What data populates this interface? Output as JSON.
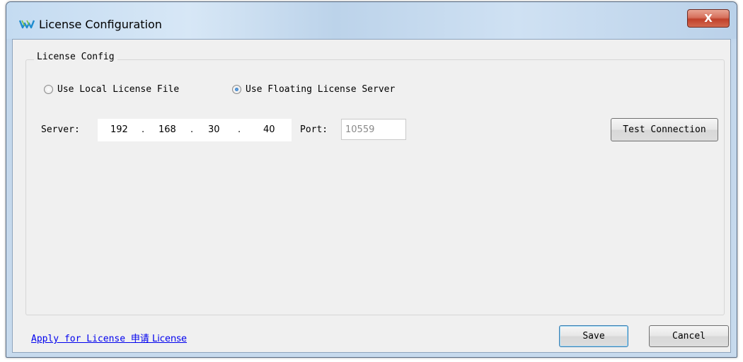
{
  "window": {
    "title": "License Configuration",
    "close_label": "X"
  },
  "group": {
    "legend": "License Config"
  },
  "radios": {
    "local_label": "Use Local License File",
    "floating_label": "Use Floating License Server",
    "selected": "floating"
  },
  "server": {
    "label": "Server:",
    "ip": [
      "192",
      "168",
      "30",
      "40"
    ],
    "dot": ".",
    "port_label": "Port:",
    "port_value": "10559"
  },
  "buttons": {
    "test_connection": "Test Connection",
    "save": "Save",
    "cancel": "Cancel"
  },
  "link": {
    "text_en": "Apply for License",
    "text_cn": "申请 License"
  },
  "colors": {
    "link": "#0000ee",
    "close_button": "#c0412b"
  }
}
